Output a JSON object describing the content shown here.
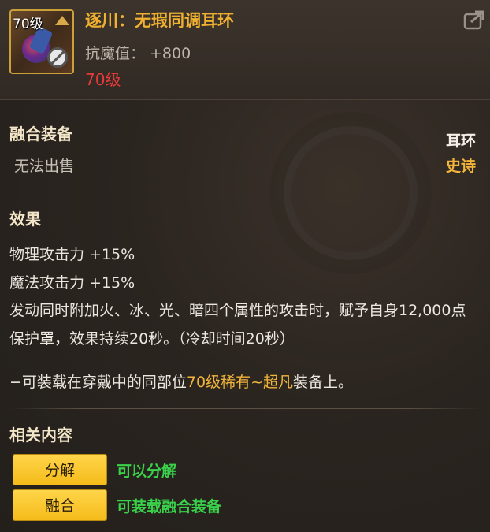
{
  "item": {
    "level_badge": "70级",
    "title": "逐川：无瑕同调耳环",
    "stat_label": "抗魔值：",
    "stat_value": "+800",
    "level_requirement": "70级"
  },
  "icons": {
    "share": "share-icon",
    "no_sell": "no-sell-icon",
    "crown": "crown-icon"
  },
  "properties": {
    "section_title": "融合装备",
    "sell_status": "无法出售",
    "slot": "耳环",
    "rarity": "史诗"
  },
  "effect": {
    "section_title": "效果",
    "line1": "物理攻击力 +15%",
    "line2": "魔法攻击力 +15%",
    "description": "发动同时附加火、冰、光、暗四个属性的攻击时，赋予自身12,000点保护罩，效果持续20秒。（冷却时间20秒）",
    "note_prefix": "−可装载在穿戴中的同部位",
    "note_highlight": "70级稀有~超凡",
    "note_suffix": "装备上。"
  },
  "related": {
    "section_title": "相关内容",
    "actions": [
      {
        "button": "分解",
        "description": "可以分解"
      },
      {
        "button": "融合",
        "description": "可装载融合装备"
      }
    ]
  },
  "colors": {
    "title": "#f0b030",
    "level_red": "#e83a3a",
    "rarity_epic": "#f2b43a",
    "action_green": "#39d24a",
    "button_yellow": "#f5bb1a"
  }
}
